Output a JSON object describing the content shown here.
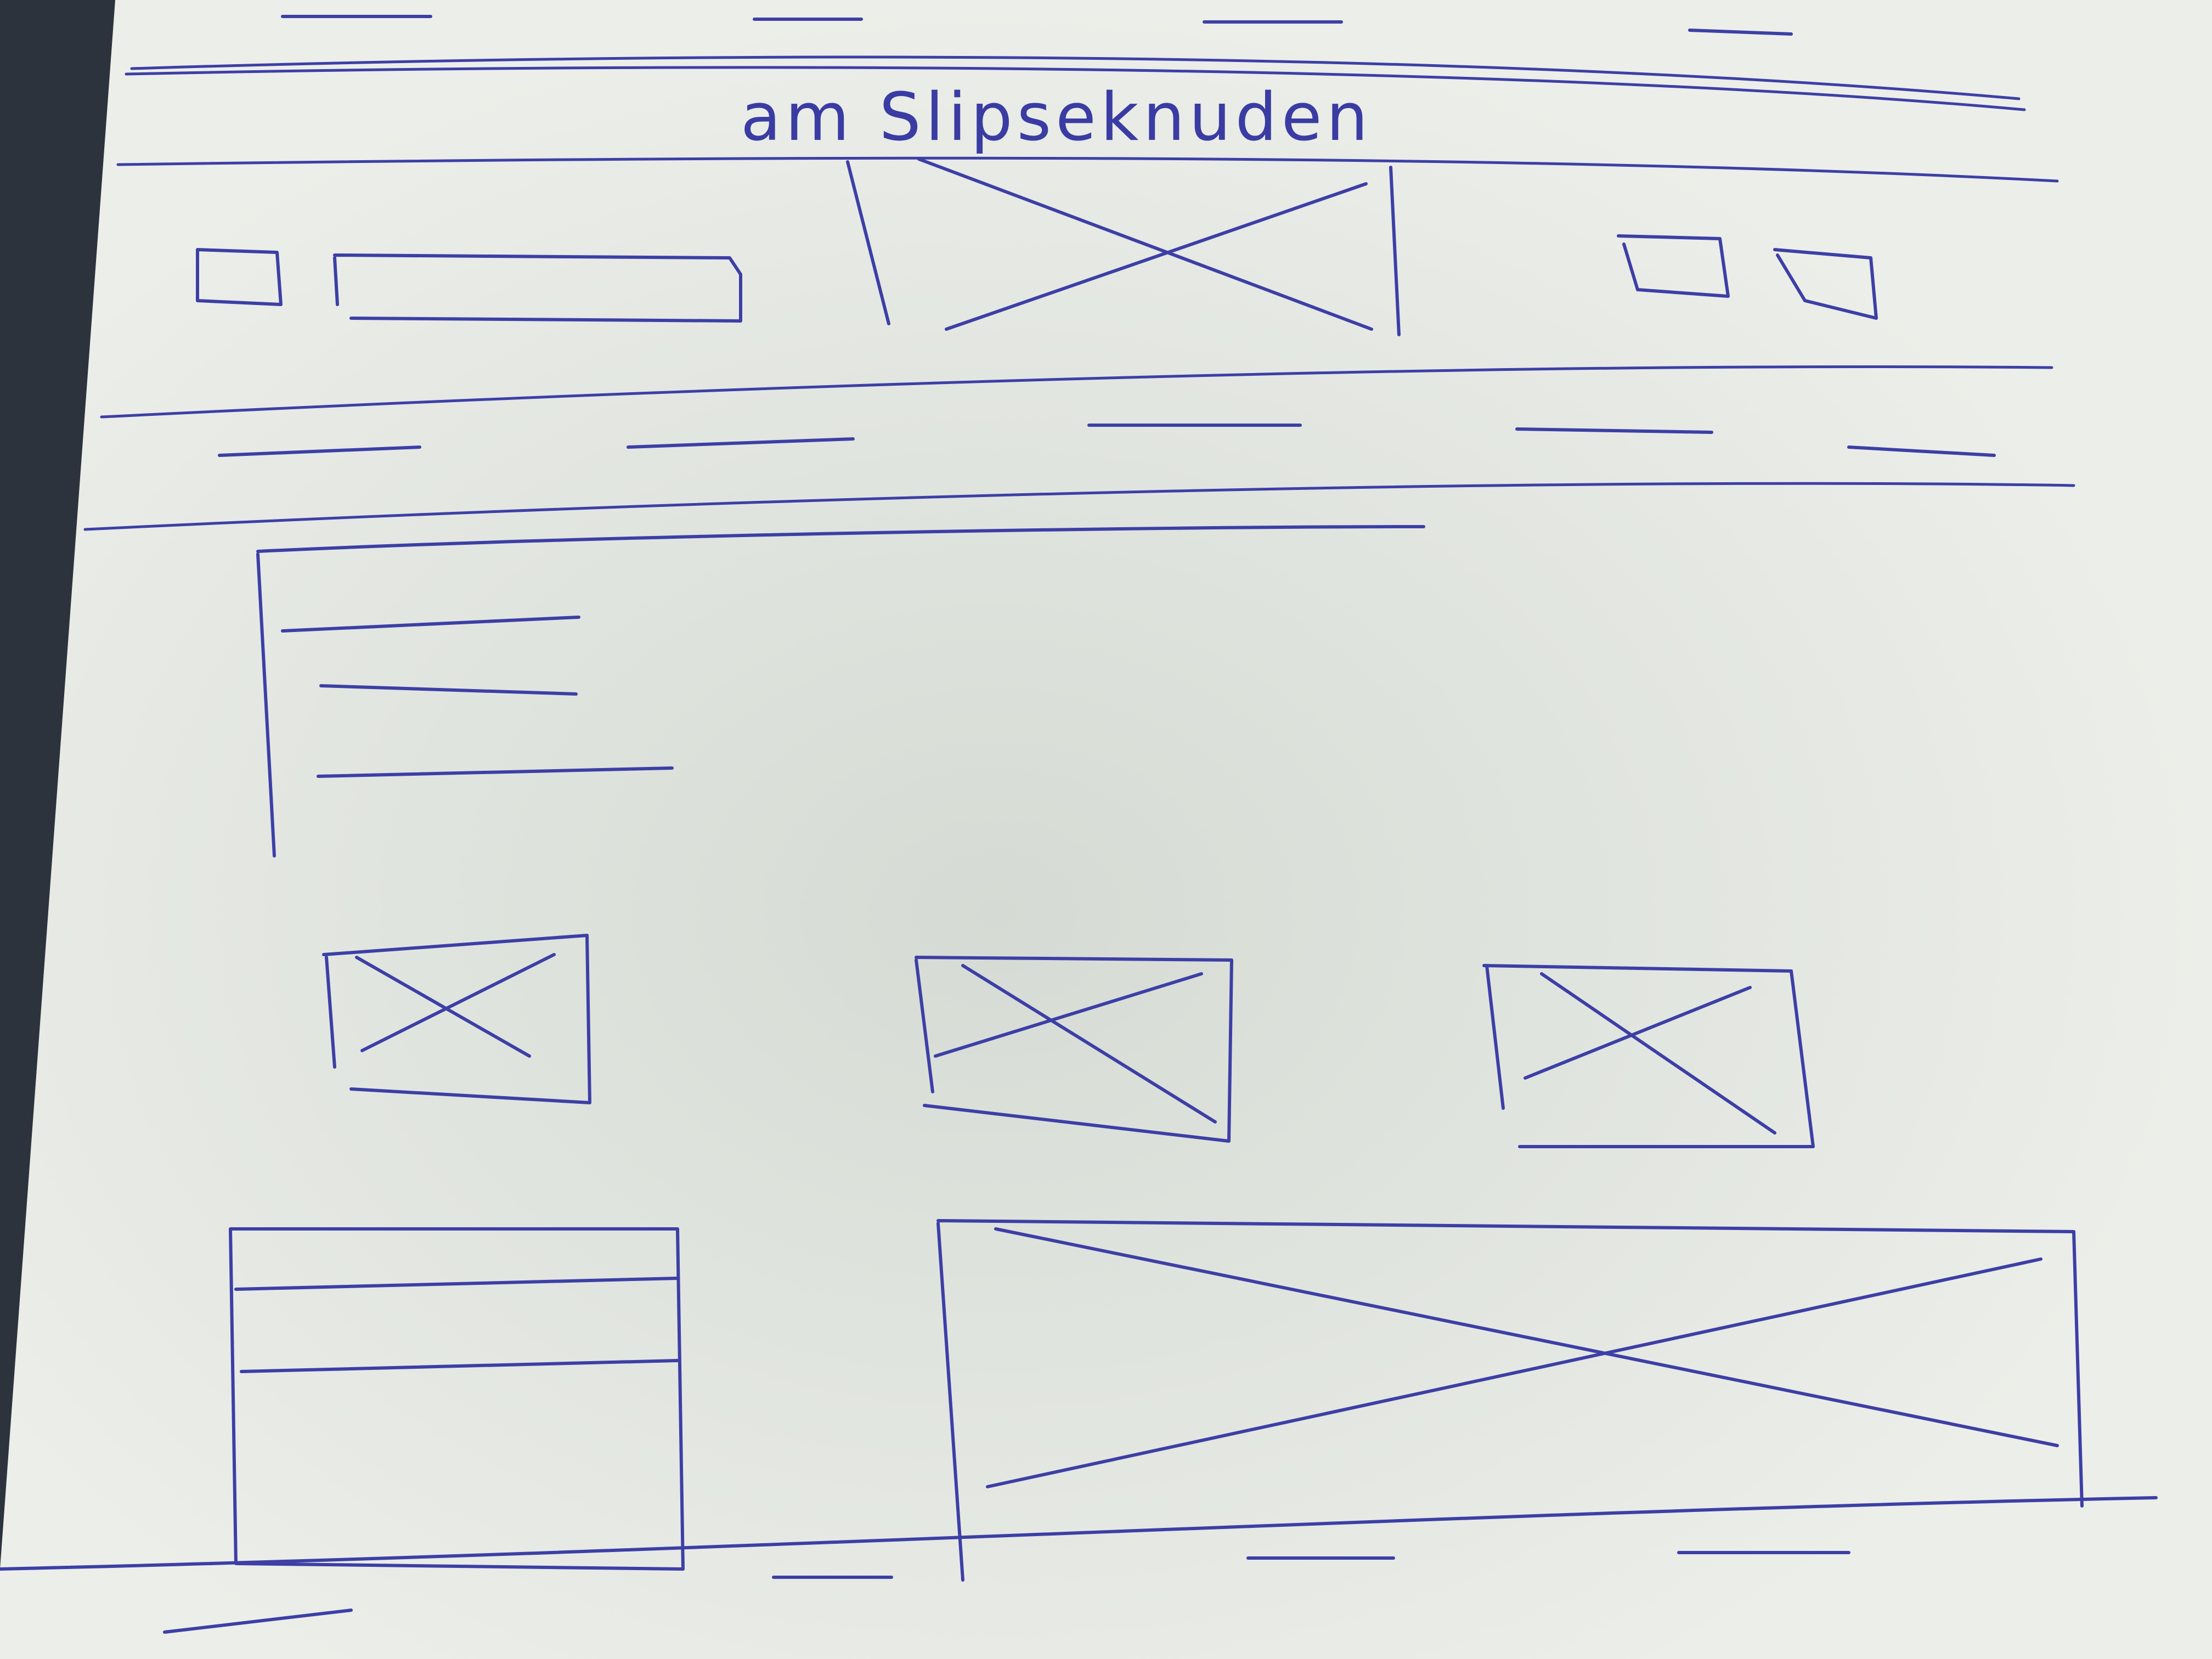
{
  "header": {
    "title": "am Slipseknuden"
  },
  "colors": {
    "paper": "#e9ece7",
    "ink": "#3d3fa6",
    "background": "#2c333d"
  },
  "icons": {
    "hero": "placeholder-image-icon",
    "thumbnail": "placeholder-image-icon",
    "feature": "placeholder-image-icon",
    "small_box": "square-icon"
  }
}
